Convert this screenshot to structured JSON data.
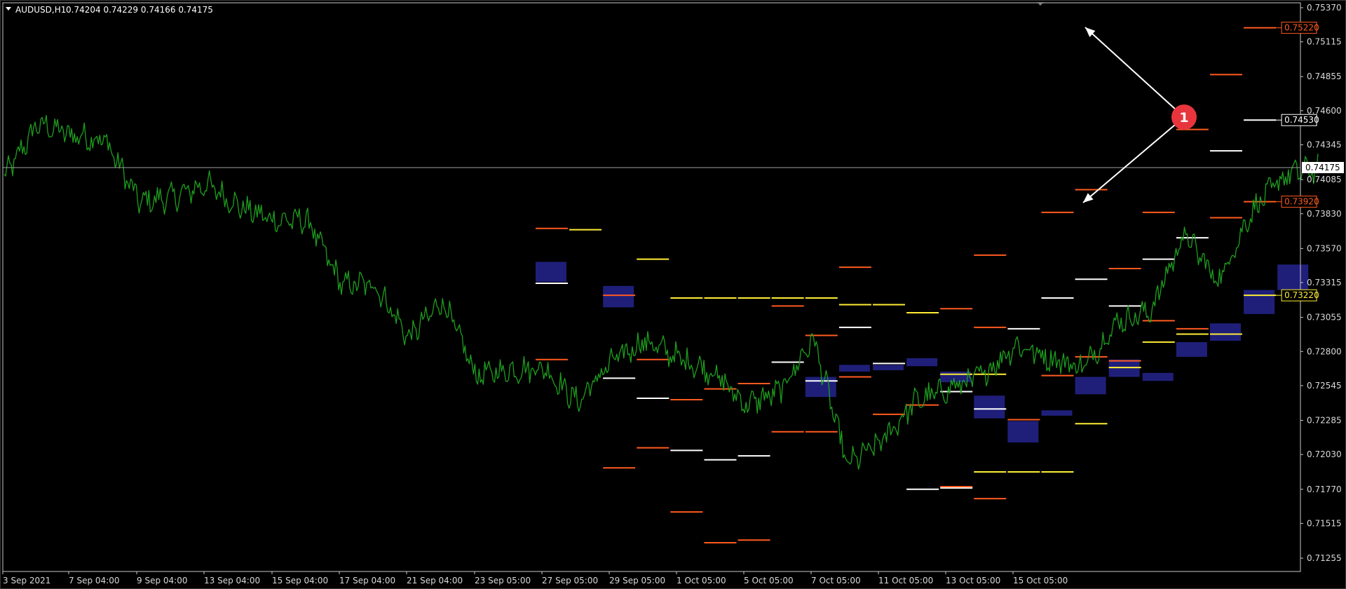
{
  "header": {
    "symbol": "AUDUSD,H1",
    "ohlc": "0.74204 0.74229 0.74166 0.74175"
  },
  "colors": {
    "background": "#000000",
    "frame": "#c8c8c8",
    "price_line": "#1e9e1e",
    "current_line": "#a0a0a0",
    "zone": "#1f1f7a",
    "level_orange": "#ff5a1f",
    "level_white": "#ffffff",
    "level_yellow": "#ffee33",
    "marker": "#e8353d",
    "arrow": "#ffffff"
  },
  "marker": {
    "label": "1"
  },
  "chart_data": {
    "type": "line",
    "title": "AUDUSD,H1",
    "timeframe": "H1",
    "ylim": [
      0.7125,
      0.7537
    ],
    "y_ticks": [
      "0.75370",
      "0.75115",
      "0.74855",
      "0.74600",
      "0.74345",
      "0.74085",
      "0.73830",
      "0.73570",
      "0.73315",
      "0.73055",
      "0.72800",
      "0.72545",
      "0.72285",
      "0.72030",
      "0.71770",
      "0.71515",
      "0.71255"
    ],
    "x_ticks": [
      "3 Sep 2021",
      "7 Sep 04:00",
      "9 Sep 04:00",
      "13 Sep 04:00",
      "15 Sep 04:00",
      "17 Sep 04:00",
      "21 Sep 04:00",
      "23 Sep 05:00",
      "27 Sep 05:00",
      "29 Sep 05:00",
      "1 Oct 05:00",
      "5 Oct 05:00",
      "7 Oct 05:00",
      "11 Oct 05:00",
      "13 Oct 05:00",
      "15 Oct 05:00"
    ],
    "current_price": "0.74175",
    "series": [
      {
        "close_by_day": [
          0.741,
          0.745,
          0.7442,
          0.7438,
          0.7392,
          0.7395,
          0.7405,
          0.7388,
          0.7378,
          0.7378,
          0.733,
          0.733,
          0.729,
          0.7318,
          0.7262,
          0.7266,
          0.7268,
          0.7242,
          0.7272,
          0.7288,
          0.7275,
          0.7265,
          0.724,
          0.725,
          0.729,
          0.7195,
          0.7212,
          0.7242,
          0.7252,
          0.7262,
          0.7285,
          0.7275,
          0.7268,
          0.7302,
          0.731,
          0.7368,
          0.7332,
          0.7385,
          0.7412,
          0.7417
        ]
      }
    ],
    "zones": [
      {
        "x": 15.8,
        "lo": 0.7332,
        "hi": 0.7347
      },
      {
        "x": 17.8,
        "lo": 0.7313,
        "hi": 0.7329
      },
      {
        "x": 23.8,
        "lo": 0.7246,
        "hi": 0.7261
      },
      {
        "x": 24.8,
        "lo": 0.7265,
        "hi": 0.727
      },
      {
        "x": 25.8,
        "lo": 0.7266,
        "hi": 0.727
      },
      {
        "x": 26.8,
        "lo": 0.7269,
        "hi": 0.7275
      },
      {
        "x": 27.8,
        "lo": 0.7257,
        "hi": 0.7265
      },
      {
        "x": 28.8,
        "lo": 0.723,
        "hi": 0.7247
      },
      {
        "x": 29.8,
        "lo": 0.7212,
        "hi": 0.7228
      },
      {
        "x": 30.8,
        "lo": 0.7232,
        "hi": 0.7236
      },
      {
        "x": 31.8,
        "lo": 0.7248,
        "hi": 0.7261
      },
      {
        "x": 32.8,
        "lo": 0.7261,
        "hi": 0.7274
      },
      {
        "x": 33.8,
        "lo": 0.7258,
        "hi": 0.7264
      },
      {
        "x": 34.8,
        "lo": 0.7276,
        "hi": 0.7287
      },
      {
        "x": 35.8,
        "lo": 0.7288,
        "hi": 0.7301
      },
      {
        "x": 36.8,
        "lo": 0.7308,
        "hi": 0.7326
      },
      {
        "x": 37.8,
        "lo": 0.7326,
        "hi": 0.7345
      }
    ],
    "levels": [
      {
        "x": 15.8,
        "price": 0.7372,
        "color": "orange"
      },
      {
        "x": 15.8,
        "price": 0.7331,
        "color": "white"
      },
      {
        "x": 15.8,
        "price": 0.7274,
        "color": "orange"
      },
      {
        "x": 16.8,
        "price": 0.7371,
        "color": "yellow"
      },
      {
        "x": 17.8,
        "price": 0.7322,
        "color": "orange"
      },
      {
        "x": 17.8,
        "price": 0.726,
        "color": "white"
      },
      {
        "x": 17.8,
        "price": 0.7193,
        "color": "orange"
      },
      {
        "x": 18.8,
        "price": 0.7349,
        "color": "yellow"
      },
      {
        "x": 18.8,
        "price": 0.7274,
        "color": "orange"
      },
      {
        "x": 18.8,
        "price": 0.7245,
        "color": "white"
      },
      {
        "x": 18.8,
        "price": 0.7208,
        "color": "orange"
      },
      {
        "x": 19.8,
        "price": 0.732,
        "color": "yellow"
      },
      {
        "x": 19.8,
        "price": 0.7244,
        "color": "orange"
      },
      {
        "x": 19.8,
        "price": 0.7206,
        "color": "white"
      },
      {
        "x": 19.8,
        "price": 0.716,
        "color": "orange"
      },
      {
        "x": 20.8,
        "price": 0.732,
        "color": "yellow"
      },
      {
        "x": 20.8,
        "price": 0.7252,
        "color": "orange"
      },
      {
        "x": 20.8,
        "price": 0.7199,
        "color": "white"
      },
      {
        "x": 20.8,
        "price": 0.7137,
        "color": "orange"
      },
      {
        "x": 21.8,
        "price": 0.732,
        "color": "yellow"
      },
      {
        "x": 21.8,
        "price": 0.7256,
        "color": "orange"
      },
      {
        "x": 21.8,
        "price": 0.7202,
        "color": "white"
      },
      {
        "x": 21.8,
        "price": 0.7139,
        "color": "orange"
      },
      {
        "x": 22.8,
        "price": 0.732,
        "color": "yellow"
      },
      {
        "x": 22.8,
        "price": 0.7314,
        "color": "orange"
      },
      {
        "x": 22.8,
        "price": 0.7272,
        "color": "white"
      },
      {
        "x": 22.8,
        "price": 0.722,
        "color": "orange"
      },
      {
        "x": 23.8,
        "price": 0.732,
        "color": "yellow"
      },
      {
        "x": 23.8,
        "price": 0.7292,
        "color": "orange"
      },
      {
        "x": 23.8,
        "price": 0.7258,
        "color": "white"
      },
      {
        "x": 23.8,
        "price": 0.722,
        "color": "orange"
      },
      {
        "x": 24.8,
        "price": 0.7343,
        "color": "orange"
      },
      {
        "x": 24.8,
        "price": 0.7315,
        "color": "yellow"
      },
      {
        "x": 24.8,
        "price": 0.7298,
        "color": "white"
      },
      {
        "x": 24.8,
        "price": 0.7261,
        "color": "orange"
      },
      {
        "x": 25.8,
        "price": 0.7315,
        "color": "yellow"
      },
      {
        "x": 25.8,
        "price": 0.7271,
        "color": "white"
      },
      {
        "x": 25.8,
        "price": 0.7233,
        "color": "orange"
      },
      {
        "x": 26.8,
        "price": 0.7309,
        "color": "yellow"
      },
      {
        "x": 26.8,
        "price": 0.724,
        "color": "orange"
      },
      {
        "x": 26.8,
        "price": 0.7177,
        "color": "white"
      },
      {
        "x": 27.8,
        "price": 0.7312,
        "color": "orange"
      },
      {
        "x": 27.8,
        "price": 0.7263,
        "color": "yellow"
      },
      {
        "x": 27.8,
        "price": 0.725,
        "color": "white"
      },
      {
        "x": 27.8,
        "price": 0.7178,
        "color": "white"
      },
      {
        "x": 27.8,
        "price": 0.7179,
        "color": "orange"
      },
      {
        "x": 28.8,
        "price": 0.7352,
        "color": "orange"
      },
      {
        "x": 28.8,
        "price": 0.7298,
        "color": "orange"
      },
      {
        "x": 28.8,
        "price": 0.7263,
        "color": "yellow"
      },
      {
        "x": 28.8,
        "price": 0.7237,
        "color": "white"
      },
      {
        "x": 28.8,
        "price": 0.719,
        "color": "yellow"
      },
      {
        "x": 28.8,
        "price": 0.717,
        "color": "orange"
      },
      {
        "x": 29.8,
        "price": 0.7297,
        "color": "white"
      },
      {
        "x": 29.8,
        "price": 0.7229,
        "color": "orange"
      },
      {
        "x": 29.8,
        "price": 0.719,
        "color": "yellow"
      },
      {
        "x": 30.8,
        "price": 0.7384,
        "color": "orange"
      },
      {
        "x": 30.8,
        "price": 0.732,
        "color": "white"
      },
      {
        "x": 30.8,
        "price": 0.7262,
        "color": "orange"
      },
      {
        "x": 30.8,
        "price": 0.719,
        "color": "yellow"
      },
      {
        "x": 31.8,
        "price": 0.7401,
        "color": "orange"
      },
      {
        "x": 31.8,
        "price": 0.7334,
        "color": "white"
      },
      {
        "x": 31.8,
        "price": 0.7276,
        "color": "orange"
      },
      {
        "x": 31.8,
        "price": 0.7226,
        "color": "yellow"
      },
      {
        "x": 32.8,
        "price": 0.7342,
        "color": "orange"
      },
      {
        "x": 32.8,
        "price": 0.7314,
        "color": "white"
      },
      {
        "x": 32.8,
        "price": 0.7273,
        "color": "orange"
      },
      {
        "x": 32.8,
        "price": 0.7268,
        "color": "yellow"
      },
      {
        "x": 33.8,
        "price": 0.7384,
        "color": "orange"
      },
      {
        "x": 33.8,
        "price": 0.7349,
        "color": "white"
      },
      {
        "x": 33.8,
        "price": 0.7303,
        "color": "orange"
      },
      {
        "x": 33.8,
        "price": 0.7287,
        "color": "yellow"
      },
      {
        "x": 34.8,
        "price": 0.7446,
        "color": "orange"
      },
      {
        "x": 34.8,
        "price": 0.7365,
        "color": "white"
      },
      {
        "x": 34.8,
        "price": 0.7297,
        "color": "orange"
      },
      {
        "x": 34.8,
        "price": 0.7293,
        "color": "yellow"
      },
      {
        "x": 35.8,
        "price": 0.7487,
        "color": "orange"
      },
      {
        "x": 35.8,
        "price": 0.743,
        "color": "white"
      },
      {
        "x": 35.8,
        "price": 0.738,
        "color": "orange"
      },
      {
        "x": 35.8,
        "price": 0.7293,
        "color": "yellow"
      },
      {
        "x": 36.8,
        "price": 0.7522,
        "color": "orange",
        "label": "0.75220"
      },
      {
        "x": 36.8,
        "price": 0.7453,
        "color": "white",
        "label": "0.74530"
      },
      {
        "x": 36.8,
        "price": 0.7392,
        "color": "orange",
        "label": "0.73920"
      },
      {
        "x": 36.8,
        "price": 0.7322,
        "color": "yellow",
        "label": "0.73220"
      }
    ]
  }
}
